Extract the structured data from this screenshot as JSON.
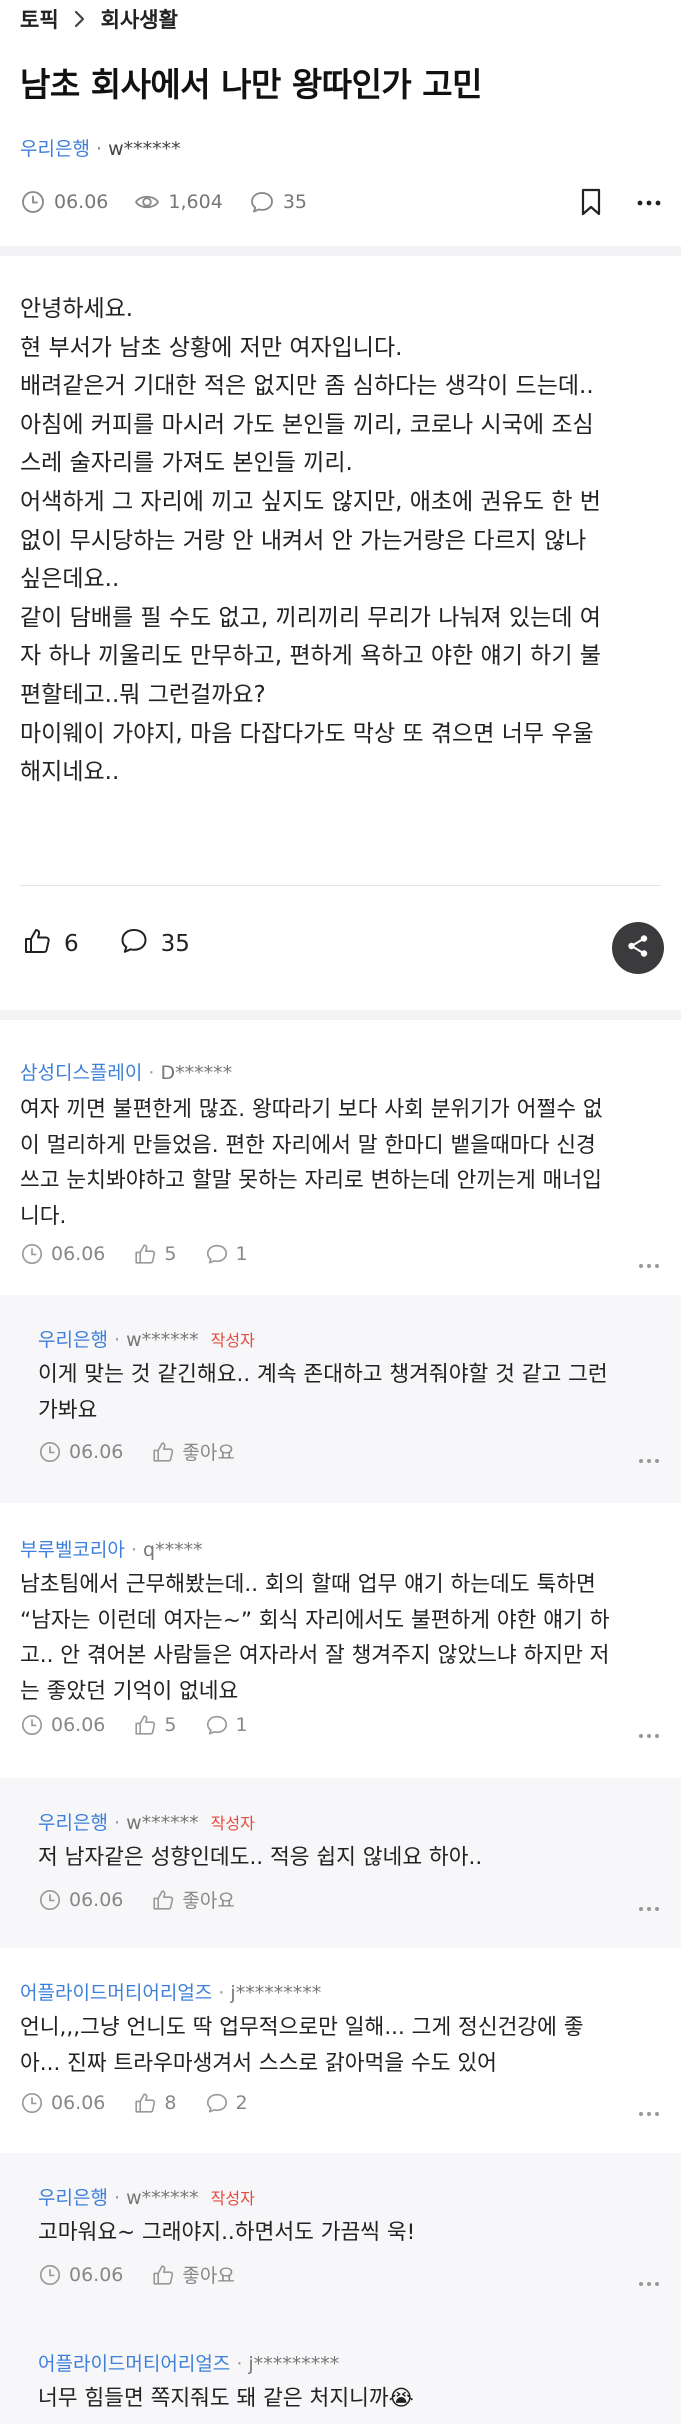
{
  "breadcrumb": {
    "topic": "토픽",
    "category": "회사생활"
  },
  "post": {
    "title": "남초 회사에서 나만 왕따인가 고민",
    "company": "우리은행",
    "separator": "·",
    "user": "w******",
    "date": "06.06",
    "views": "1,604",
    "comments": "35",
    "body_lines": [
      "안녕하세요.",
      "현 부서가 남초 상황에 저만 여자입니다.",
      "배려같은거 기대한 적은 없지만 좀 심하다는 생각이 드는데..",
      "아침에 커피를 마시러 가도 본인들 끼리, 코로나 시국에 조심",
      "스레 술자리를 가져도 본인들 끼리.",
      "어색하게 그 자리에 끼고 싶지도 않지만, 애초에 권유도 한 번",
      "없이 무시당하는 거랑 안 내켜서 안 가는거랑은 다르지 않나",
      "싶은데요..",
      "같이 담배를 필 수도 없고, 끼리끼리 무리가 나눠져 있는데 여",
      "자 하나 끼울리도 만무하고, 편하게 욕하고 야한 얘기 하기 불",
      "편할테고..뭐 그런걸까요?",
      "마이웨이 가야지, 마음 다잡다가도 막상 또 겪으면 너무 우울",
      "해지네요.."
    ],
    "likes": "6",
    "comment_count": "35"
  },
  "comments": [
    {
      "company": "삼성디스플레이",
      "user": "D******",
      "op": "",
      "lines": [
        "여자 끼면 불편한게 많죠. 왕따라기 보다 사회 분위기가 어쩔수 없",
        "이 멀리하게 만들었음. 편한 자리에서 말 한마디 뱉을때마다 신경",
        "쓰고 눈치봐야하고 할말 못하는 자리로 변하는데 안끼는게 매너입",
        "니다."
      ],
      "date": "06.06",
      "likes": "5",
      "replies": "1"
    },
    {
      "company": "우리은행",
      "user": "w******",
      "op": "작성자",
      "lines": [
        "이게 맞는 것 같긴해요.. 계속 존대하고 챙겨줘야할 것 같고 그런",
        "가봐요"
      ],
      "date": "06.06",
      "like_label": "좋아요"
    },
    {
      "company": "부루벨코리아",
      "user": "q*****",
      "op": "",
      "lines": [
        "남초팀에서 근무해봤는데.. 회의 할때 업무 얘기 하는데도 툭하면",
        "“남자는 이런데 여자는~” 회식 자리에서도 불편하게 야한 얘기 하",
        "고.. 안 겪어본 사람들은 여자라서 잘 챙겨주지 않았느냐 하지만 저",
        "는 좋았던 기억이 없네요"
      ],
      "date": "06.06",
      "likes": "5",
      "replies": "1"
    },
    {
      "company": "우리은행",
      "user": "w******",
      "op": "작성자",
      "lines": [
        "저 남자같은 성향인데도.. 적응 쉽지 않네요 하아.."
      ],
      "date": "06.06",
      "like_label": "좋아요"
    },
    {
      "company": "어플라이드머티어리얼즈",
      "user": "j*********",
      "op": "",
      "lines": [
        "언니,,,그냥 언니도 딱 업무적으로만 일해... 그게 정신건강에 좋",
        "아... 진짜 트라우마생겨서 스스로 갉아먹을 수도 있어"
      ],
      "date": "06.06",
      "likes": "8",
      "replies": "2"
    },
    {
      "company": "우리은행",
      "user": "w******",
      "op": "작성자",
      "lines": [
        "고마워요~ 그래야지..하면서도 가끔씩 욱!"
      ],
      "date": "06.06",
      "like_label": "좋아요"
    },
    {
      "company": "어플라이드머티어리얼즈",
      "user": "j*********",
      "op": "",
      "lines": [
        "너무 힘들면 쪽지줘도 돼 같은 처지니까😭"
      ]
    }
  ],
  "colors": {
    "company_blue": "#3d7fd9",
    "op_red": "#e44a3d",
    "share_bg": "#3b3b3d"
  },
  "icons": [
    "chevron-right-icon",
    "clock-icon",
    "eye-icon",
    "speech-bubble-icon",
    "bookmark-icon",
    "more-icon",
    "thumbs-up-icon",
    "share-icon"
  ]
}
